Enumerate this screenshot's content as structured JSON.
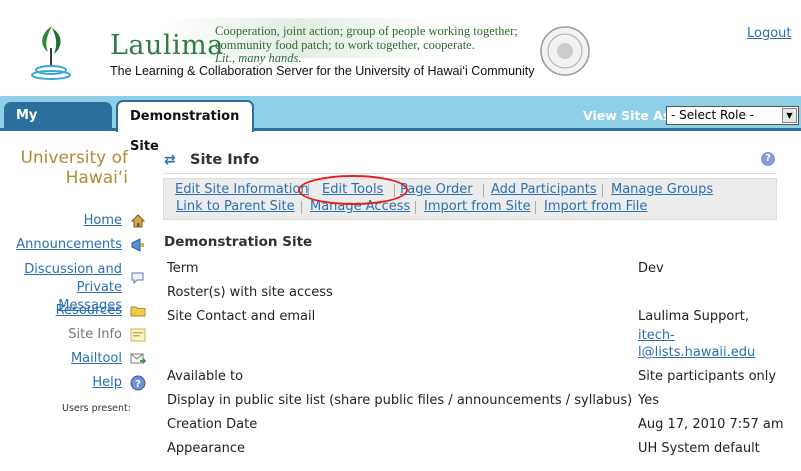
{
  "header": {
    "brand": "Laulima",
    "tagline": [
      "Cooperation, joint action; group of people working together;",
      "community food patch; to work together, cooperate.",
      "Lit., many hands."
    ],
    "subtitle": "The Learning & Collaboration Server for the University of Hawai‘i Community",
    "logout": "Logout"
  },
  "tabs": [
    {
      "label": "My Workspace",
      "active": false
    },
    {
      "label": "Demonstration Site",
      "active": true
    }
  ],
  "view_as": {
    "label": "View Site As:",
    "selected": "- Select Role -"
  },
  "sidebar": {
    "title": "University of Hawai‘i",
    "items": [
      {
        "label": "Home",
        "icon": "house-icon"
      },
      {
        "label": "Announcements",
        "icon": "megaphone-icon"
      },
      {
        "label": "Discussion and Private Messages",
        "icon": "speech-bubble-icon"
      },
      {
        "label": "Resources",
        "icon": "folder-icon"
      },
      {
        "label": "Site Info",
        "icon": "site-info-icon",
        "current": true
      },
      {
        "label": "Mailtool",
        "icon": "mail-icon"
      },
      {
        "label": "Help",
        "icon": "help-icon"
      }
    ],
    "users_present": "Users present:"
  },
  "main": {
    "tool_title": "Site Info",
    "toolbar": [
      "Edit Site Information",
      "Edit Tools",
      "Page Order",
      "Add Participants",
      "Manage Groups",
      "Link to Parent Site",
      "Manage Access",
      "Import from Site",
      "Import from File"
    ],
    "section_title": "Demonstration Site",
    "rows": [
      {
        "label": "Term",
        "value": "Dev"
      },
      {
        "label": "Roster(s) with site access",
        "value": ""
      },
      {
        "label": "Site Contact and email",
        "value": "Laulima Support,",
        "email_1": "itech-",
        "email_2": "l@lists.hawaii.edu"
      },
      {
        "label": "Available to",
        "value": "Site participants only"
      },
      {
        "label": "Display in public site list (share public files / announcements / syllabus)",
        "value": "Yes"
      },
      {
        "label": "Creation Date",
        "value": "Aug 17, 2010 7:57 am"
      },
      {
        "label": "Appearance",
        "value": "UH System default"
      }
    ]
  },
  "colors": {
    "tabbar": "#8fd0e8",
    "tab_dark": "#2b6f9c",
    "link": "#2a6fb0",
    "brand_green": "#2f7d3f",
    "site_title": "#b08a3a",
    "highlight": "#e02020"
  }
}
